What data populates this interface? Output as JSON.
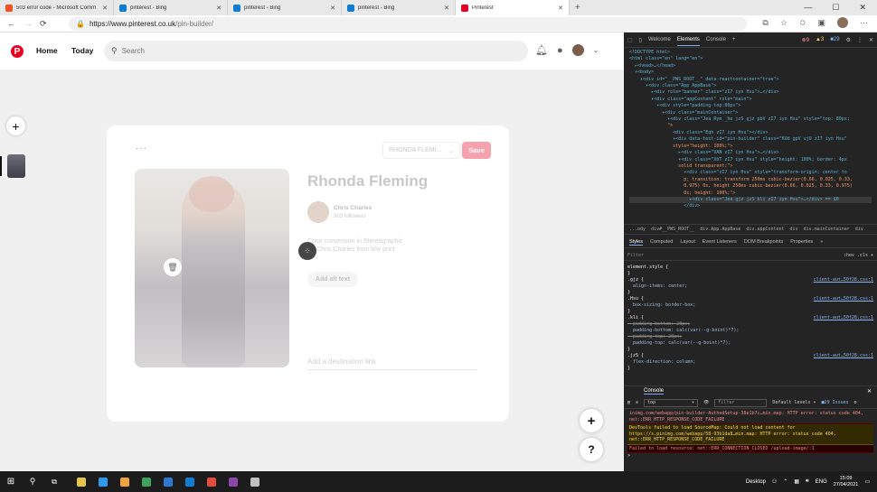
{
  "browser": {
    "tabs": [
      {
        "label": "503 error code - Microsoft Comm",
        "icon_color": "#f25022",
        "active": false
      },
      {
        "label": "pinterest - Bing",
        "icon_color": "#0f7dd4",
        "active": false
      },
      {
        "label": "pinterest - Bing",
        "icon_color": "#0f7dd4",
        "active": false
      },
      {
        "label": "pinterest - Bing",
        "icon_color": "#0f7dd4",
        "active": false
      },
      {
        "label": "Pinterest",
        "icon_color": "#e60023",
        "active": true
      }
    ],
    "url_host": "https://www.pinterest.co.uk",
    "url_path": "/pin-builder/"
  },
  "pinterest": {
    "logo_glyph": "P",
    "nav_home": "Home",
    "nav_today": "Today",
    "search_placeholder": "Search",
    "sidebar_add": "+",
    "board_select": "RHONDA FLEMI...",
    "save_label": "Save",
    "more_dots": "···",
    "pin_title": "Rhonda Fleming",
    "creator_name": "Chris Charles",
    "creator_followers": "303 followers",
    "description_line1": "Color conversion in Stereographic",
    "description_line2": "Chris Charles from b/w print",
    "alt_text_button": "Add alt text",
    "destination_placeholder": "Add a destination link",
    "fab_add": "+",
    "fab_help": "?",
    "brand_color": "#e60023"
  },
  "devtools": {
    "tabs": [
      "Welcome",
      "Elements",
      "Console"
    ],
    "active_tab": "Elements",
    "counts": {
      "errors": "9",
      "warnings": "3",
      "info": "29"
    },
    "dom_lines": [
      "<!DOCTYPE html>",
      "<html class=\"en\" lang=\"en\">",
      "  ▸<head>…</head>",
      "  ▾<body>",
      "    ▾<div id=\"__PWS_ROOT__\" data-reactcontainer=\"true\">",
      "      ▾<div class=\"App AppBase\">",
      "        ▸<div role=\"banner\" class=\"zI7 iyn Hsu\">…</div>",
      "        ▾<div class=\"appContent\" role=\"main\">",
      "          ▾<div style=\"padding-top:80px\">",
      "            ▾<div class=\"mainContainer\">",
      "              ▾<div class=\"Jea Rym _he jzS gjz pbV zI7 iyn Hsu\" style=\"top: 80px;",
      "              \">",
      "                <div class=\"Eqh zI7 iyn Hsu\"></div>",
      "                ▾<div data-test-id=\"pin-builder\" class=\"KUd gpV ujU zI7 iyn Hsu\"",
      "                style=\"height: 100%;\">",
      "                  ▸<div class=\"VAN zI7 iyn Hsu\">…</div>",
      "                  ▾<div class=\"XhT zI7 iyn Hsu\" style=\"height: 100%; border: 4px",
      "                  solid transparent;\">",
      "                    ▾<div class=\"zI7 iyn Hsu\" style=\"transform-origin: center to",
      "                    p; transition: transform 250ms cubic-bezier(0.66, 0.025, 0.33,",
      "                    0.975) 0s, height 250ms cubic-bezier(0.66, 0.025, 0.33, 0.975)",
      "                    0s; height: 100%;\">",
      "                      ▸<div class=\"Jea gjz jzS kli zI7 iyn Hsu\">…</div> == $0",
      "                    </div>"
    ],
    "breadcrumbs": [
      "...ody",
      "div#__PWS_ROOT__",
      "div.App.AppBase",
      "div.appContent",
      "div",
      "div.mainContainer",
      "div"
    ],
    "subtabs": [
      "Styles",
      "Computed",
      "Layout",
      "Event Listeners",
      "DOM Breakpoints",
      "Properties",
      "»"
    ],
    "filter_placeholder": "Filter",
    "filter_right": ":hov .cls +",
    "style_rules": [
      {
        "selector": "element.style {",
        "props": [],
        "source": ""
      },
      {
        "selector": ".gjz {",
        "props": [
          "align-items: center;"
        ],
        "source": "client-aut…50f28.css:1"
      },
      {
        "selector": ".Hsu {",
        "props": [
          "box-sizing: border-box;"
        ],
        "source": "client-aut…50f28.css:1"
      },
      {
        "selector": ".kli {",
        "props": [
          "~padding-bottom: 28px;",
          "padding-bottom: calc(var(--g-boint)*7);",
          "~padding-top: 28px;",
          "padding-top: calc(var(--g-boint)*7);"
        ],
        "source": "client-aut…50f28.css:1"
      },
      {
        "selector": ".jzS {",
        "props": [
          "flex-direction: column;"
        ],
        "source": "client-aut…50f28.css:1"
      }
    ],
    "console_title": "Console",
    "console_context": "top",
    "console_filter": "Filter",
    "console_levels": "Default levels ▾",
    "console_issues": "29 Issues",
    "console_msgs": [
      {
        "kind": "plain",
        "text": "inimg.com/webapp/pin-builder-AuthedSetup-38e1b7c…min.map: HTTP error: status code 404, net::ERR_HTTP_RESPONSE_CODE_FAILURE"
      },
      {
        "kind": "warn",
        "text": "DevTools failed to load SourceMap: Could not load content for https://s.pinimg.com/webapp/58-93b1da8…min.map: HTTP error: status code 404, net::ERR_HTTP_RESPONSE_CODE_FAILURE"
      },
      {
        "kind": "err",
        "text": "Failed to load resource: net::ERR_CONNECTION_CLOSED        /upload-image/:1"
      }
    ],
    "console_prompt": ">"
  },
  "taskbar": {
    "desktop_label": "Desktop",
    "lang": "ENG",
    "time": "15:09",
    "date": "27/04/2021",
    "app_colors": [
      "#e8c547",
      "#2d9bf0",
      "#f2a33a",
      "#3ba55d",
      "#2b79d0",
      "#0f7dd4",
      "#e64b3c",
      "#8e44ad",
      "#c0c0c0"
    ]
  }
}
